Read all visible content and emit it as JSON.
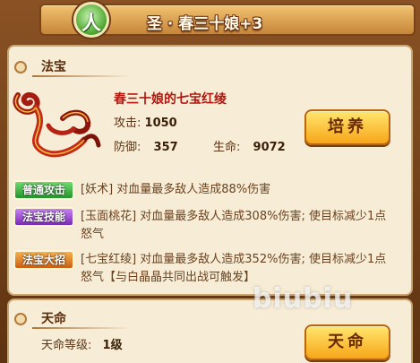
{
  "header": {
    "badge_glyph": "人",
    "title": "圣 · 春三十娘+3"
  },
  "treasure_section": {
    "title": "法宝",
    "item_name": "春三十娘的七宝红绫",
    "attack_label": "攻击:",
    "attack_value": "1050",
    "defense_label": "防御:",
    "defense_value": "357",
    "hp_label": "生命:",
    "hp_value": "9072",
    "cultivate_button": "培养",
    "icon": "red-silk-ribbon-icon"
  },
  "skills": [
    {
      "tag": "普通攻击",
      "text": "[妖术] 对血量最多敌人造成88%伤害",
      "color": "#24952c"
    },
    {
      "tag": "法宝技能",
      "text": "[玉面桃花] 对血量最多敌人造成308%伤害; 使目标减少1点怒气",
      "color": "#7a2bb3"
    },
    {
      "tag": "法宝大招",
      "text": "[七宝红绫] 对血量最多敌人造成352%伤害; 使目标减少1点怒气【与白晶晶共同出战可触发】",
      "color": "#c95f12"
    }
  ],
  "destiny_section": {
    "title": "天命",
    "level_label": "天命等级:",
    "level_value": "1级",
    "destiny_button": "天命"
  },
  "watermark": "biubiu"
}
